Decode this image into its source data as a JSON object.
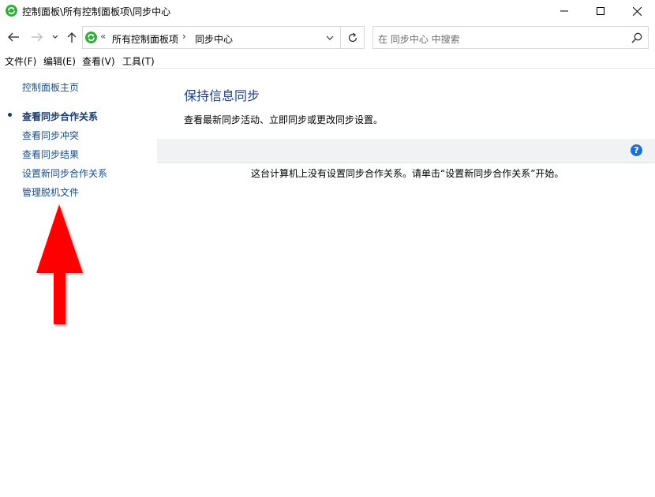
{
  "window": {
    "title": "控制面板\\所有控制面板项\\同步中心",
    "icon": "sync-center-icon",
    "controls": [
      "minimize-icon",
      "maximize-icon",
      "close-icon"
    ]
  },
  "nav": {
    "back": "back-arrow-icon",
    "forward": "forward-arrow-icon",
    "recent": "chevron-down-icon",
    "up": "up-arrow-icon"
  },
  "address": {
    "prefix": "«",
    "crumbs": [
      "所有控制面板项",
      "同步中心"
    ],
    "separator": "›"
  },
  "search": {
    "placeholder": "在 同步中心 中搜索"
  },
  "menu": {
    "file": "文件(F)",
    "edit": "编辑(E)",
    "view": "查看(V)",
    "tools": "工具(T)"
  },
  "left_pane": {
    "home": "控制面板主页",
    "current": "查看同步合作关系",
    "conflicts": "查看同步冲突",
    "results": "查看同步结果",
    "new_partnership": "设置新同步合作关系",
    "offline_files": "管理脱机文件"
  },
  "main": {
    "title": "保持信息同步",
    "description": "查看最新同步活动、立即同步或更改同步设置。",
    "empty_message": "这台计算机上没有设置同步合作关系。请单击“设置新同步合作关系”开始。",
    "help": "?"
  },
  "colors": {
    "link": "#1a4e8a",
    "title": "#1e3f8a",
    "annotation_arrow": "#ff0000",
    "help": "#1f6fd1",
    "sync_icon": "#2fae3a"
  }
}
